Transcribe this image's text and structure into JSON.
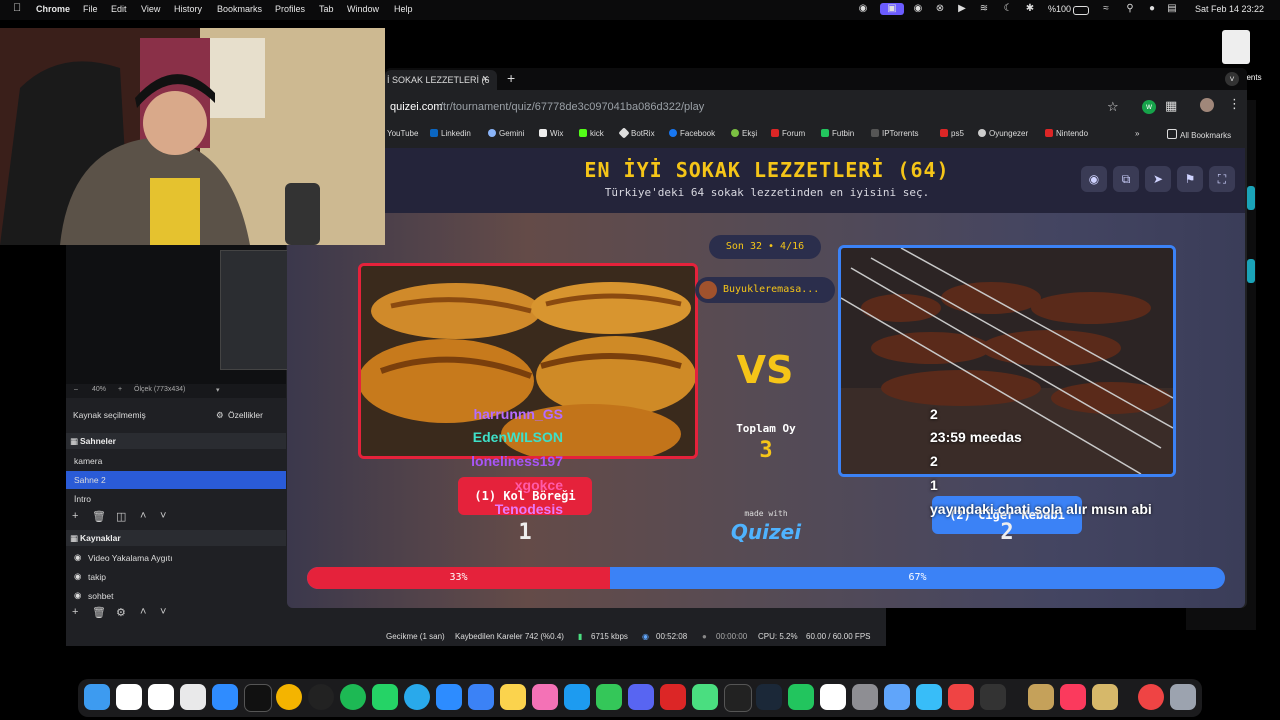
{
  "menubar": {
    "app": "Chrome",
    "items": [
      "File",
      "Edit",
      "View",
      "History",
      "Bookmarks",
      "Profiles",
      "Tab",
      "Window",
      "Help"
    ],
    "battery": "%100",
    "datetime": "Sat Feb 14  23:22"
  },
  "browser": {
    "tab_title": "İ SOKAK LEZZETLERİ (6",
    "url_host": "quizei.com",
    "url_path": "/tr/tournament/quiz/67778de3c097041ba086d322/play",
    "bookmarks": [
      "YouTube",
      "Linkedin",
      "Gemini",
      "Wix",
      "kick",
      "BotRix",
      "Facebook",
      "Ekşi",
      "Forum",
      "Futbin",
      "IPTorrents",
      "ps5",
      "Oyungezer",
      "Nintendo"
    ],
    "all_bookmarks": "All Bookmarks"
  },
  "quiz": {
    "title": "EN İYİ SOKAK LEZZETLERİ (64)",
    "subtitle": "Türkiye'deki 64 sokak lezzetinden en iyisini seç.",
    "round": "Son 32 • 4/16",
    "user": "Buyukleremasa...",
    "vs": "VS",
    "total_label": "Toplam Oy",
    "total_votes": "3",
    "left_option": "(1) Kol Böreği",
    "left_votes": "1",
    "right_option": "(2) Ciğer Kebabı",
    "right_votes": "2",
    "made_with": "made with",
    "brand": "Quizei",
    "left_pct_label": "33%",
    "right_pct_label": "67%",
    "left_fraction": 0.33
  },
  "chat": [
    {
      "user": "harrunnn_GS",
      "message": "2",
      "color": "#b56cff"
    },
    {
      "user": "EdenWILSON",
      "message": "23:59 meedas",
      "color": "#3ee0c8"
    },
    {
      "user": "loneliness197",
      "message": "2",
      "color": "#a855f7"
    },
    {
      "user": "xgokce",
      "message": "1",
      "color": "#ff5aa8"
    },
    {
      "user": "Tenodesis",
      "message": "yayındaki chati sola alır mısın abi",
      "color": "#e879f9"
    }
  ],
  "obs": {
    "zoom": "40%",
    "scale": "Ölçek (773x434)",
    "no_source": "Kaynak seçilmemiş",
    "properties": "Özellikler",
    "scenes_header": "Sahneler",
    "scenes": [
      "kamera",
      "Sahne 2",
      "İntro"
    ],
    "sources_header": "Kaynaklar",
    "sources": [
      "Video Yakalama Aygıtı",
      "takip",
      "sohbet"
    ],
    "status": {
      "delay": "Gecikme (1 san)",
      "dropped": "Kaybedilen Kareler 742 (%0.4)",
      "bitrate": "6715 kbps",
      "live_time": "00:52:08",
      "rec_time": "00:00:00",
      "cpu": "CPU: 5.2%",
      "fps": "60.00 / 60.00 FPS"
    }
  },
  "desktop": {
    "right_label": "nents"
  },
  "colors": {
    "accent_yellow": "#f5c518",
    "left_red": "#e5223b",
    "right_blue": "#3b82f6"
  }
}
